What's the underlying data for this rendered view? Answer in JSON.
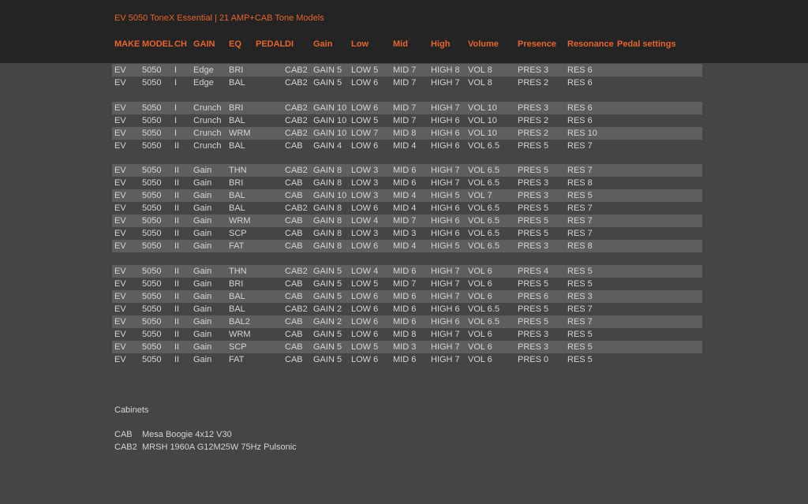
{
  "title": "EV 5050 ToneX Essential | 21 AMP+CAB Tone Models",
  "columns": [
    "MAKE",
    "MODEL",
    "CH",
    "GAIN",
    "EQ",
    "PEDAL",
    "DI",
    "Gain",
    "Low",
    "Mid",
    "High",
    "Volume",
    "Presence",
    "Resonance",
    "Pedal settings"
  ],
  "colors": {
    "accent": "#e8632a",
    "background": "#454545",
    "header_bg": "#242424",
    "row_shade": "#5e5e5e",
    "text": "#d4d4d4"
  },
  "rows": [
    {
      "shaded": true,
      "cells": [
        "EV",
        "5050",
        "I",
        "Edge",
        "BRI",
        "",
        "CAB2",
        "GAIN 5",
        "LOW 5",
        "MID 7",
        "HIGH 8",
        "VOL 8",
        "PRES 3",
        "RES 6",
        ""
      ]
    },
    {
      "shaded": false,
      "cells": [
        "EV",
        "5050",
        "I",
        "Edge",
        "BAL",
        "",
        "CAB2",
        "GAIN 5",
        "LOW 6",
        "MID 7",
        "HIGH 7",
        "VOL 8",
        "PRES 2",
        "RES 6",
        ""
      ]
    },
    {
      "shaded": true,
      "cells": [
        "EV",
        "5050",
        "I",
        "Crunch",
        "BRI",
        "",
        "CAB2",
        "GAIN 10",
        "LOW 6",
        "MID 7",
        "HIGH 7",
        "VOL 10",
        "PRES 3",
        "RES 6",
        ""
      ]
    },
    {
      "shaded": false,
      "cells": [
        "EV",
        "5050",
        "I",
        "Crunch",
        "BAL",
        "",
        "CAB2",
        "GAIN 10",
        "LOW 5",
        "MID 7",
        "HIGH 6",
        "VOL 10",
        "PRES 2",
        "RES 6",
        ""
      ]
    },
    {
      "shaded": true,
      "cells": [
        "EV",
        "5050",
        "I",
        "Crunch",
        "WRM",
        "",
        "CAB2",
        "GAIN 10",
        "LOW 7",
        "MID 8",
        "HIGH 6",
        "VOL 10",
        "PRES 2",
        "RES 10",
        ""
      ]
    },
    {
      "shaded": false,
      "cells": [
        "EV",
        "5050",
        "II",
        "Crunch",
        "BAL",
        "",
        "CAB",
        "GAIN 4",
        "LOW 6",
        "MID 4",
        "HIGH 6",
        "VOL 6.5",
        "PRES 5",
        "RES 7",
        ""
      ]
    },
    {
      "shaded": true,
      "cells": [
        "EV",
        "5050",
        "II",
        "Gain",
        "THN",
        "",
        "CAB2",
        "GAIN 8",
        "LOW 3",
        "MID 6",
        "HIGH 7",
        "VOL 6.5",
        "PRES 5",
        "RES 7",
        ""
      ]
    },
    {
      "shaded": false,
      "cells": [
        "EV",
        "5050",
        "II",
        "Gain",
        "BRI",
        "",
        "CAB",
        "GAIN 8",
        "LOW 3",
        "MID 6",
        "HIGH 7",
        "VOL 6.5",
        "PRES 3",
        "RES 8",
        ""
      ]
    },
    {
      "shaded": true,
      "cells": [
        "EV",
        "5050",
        "II",
        "Gain",
        "BAL",
        "",
        "CAB",
        "GAIN 10",
        "LOW 3",
        "MID 4",
        "HIGH 5",
        "VOL 7",
        "PRES 3",
        "RES 5",
        ""
      ]
    },
    {
      "shaded": false,
      "cells": [
        "EV",
        "5050",
        "II",
        "Gain",
        "BAL",
        "",
        "CAB2",
        "GAIN 8",
        "LOW 6",
        "MID 4",
        "HIGH 6",
        "VOL 6.5",
        "PRES 5",
        "RES 7",
        ""
      ]
    },
    {
      "shaded": true,
      "cells": [
        "EV",
        "5050",
        "II",
        "Gain",
        "WRM",
        "",
        "CAB",
        "GAIN 8",
        "LOW 4",
        "MID 7",
        "HIGH 6",
        "VOL 6.5",
        "PRES 5",
        "RES 7",
        ""
      ]
    },
    {
      "shaded": false,
      "cells": [
        "EV",
        "5050",
        "II",
        "Gain",
        "SCP",
        "",
        "CAB",
        "GAIN 8",
        "LOW 3",
        "MID 3",
        "HIGH 6",
        "VOL 6.5",
        "PRES 5",
        "RES 7",
        ""
      ]
    },
    {
      "shaded": true,
      "cells": [
        "EV",
        "5050",
        "II",
        "Gain",
        "FAT",
        "",
        "CAB",
        "GAIN 8",
        "LOW 6",
        "MID 4",
        "HIGH 5",
        "VOL 6.5",
        "PRES 3",
        "RES 8",
        ""
      ]
    },
    {
      "shaded": true,
      "cells": [
        "EV",
        "5050",
        "II",
        "Gain",
        "THN",
        "",
        "CAB2",
        "GAIN 5",
        "LOW 4",
        "MID 6",
        "HIGH 7",
        "VOL 6",
        "PRES 4",
        "RES 5",
        ""
      ]
    },
    {
      "shaded": false,
      "cells": [
        "EV",
        "5050",
        "II",
        "Gain",
        "BRI",
        "",
        "CAB",
        "GAIN 5",
        "LOW 5",
        "MID 7",
        "HIGH 7",
        "VOL 6",
        "PRES 5",
        "RES 5",
        ""
      ]
    },
    {
      "shaded": true,
      "cells": [
        "EV",
        "5050",
        "II",
        "Gain",
        "BAL",
        "",
        "CAB",
        "GAIN 5",
        "LOW 6",
        "MID 6",
        "HIGH 7",
        "VOL 6",
        "PRES 6",
        "RES 3",
        ""
      ]
    },
    {
      "shaded": false,
      "cells": [
        "EV",
        "5050",
        "II",
        "Gain",
        "BAL",
        "",
        "CAB2",
        "GAIN 2",
        "LOW 6",
        "MID 6",
        "HIGH 6",
        "VOL 6.5",
        "PRES 5",
        "RES 7",
        ""
      ]
    },
    {
      "shaded": true,
      "cells": [
        "EV",
        "5050",
        "II",
        "Gain",
        "BAL2",
        "",
        "CAB",
        "GAIN 2",
        "LOW 6",
        "MID 6",
        "HIGH 6",
        "VOL 6.5",
        "PRES 5",
        "RES 7",
        ""
      ]
    },
    {
      "shaded": false,
      "cells": [
        "EV",
        "5050",
        "II",
        "Gain",
        "WRM",
        "",
        "CAB",
        "GAIN 5",
        "LOW 6",
        "MID 8",
        "HIGH 7",
        "VOL 6",
        "PRES 3",
        "RES 5",
        ""
      ]
    },
    {
      "shaded": true,
      "cells": [
        "EV",
        "5050",
        "II",
        "Gain",
        "SCP",
        "",
        "CAB",
        "GAIN 5",
        "LOW 5",
        "MID 3",
        "HIGH 7",
        "VOL 6",
        "PRES 3",
        "RES 5",
        ""
      ]
    },
    {
      "shaded": false,
      "cells": [
        "EV",
        "5050",
        "II",
        "Gain",
        "FAT",
        "",
        "CAB",
        "GAIN 5",
        "LOW 6",
        "MID 6",
        "HIGH 7",
        "VOL 6",
        "PRES 0",
        "RES 5",
        ""
      ]
    }
  ],
  "cabinets": {
    "title": "Cabinets",
    "items": [
      {
        "code": "CAB",
        "name": "Mesa Boogie 4x12 V30"
      },
      {
        "code": "CAB2",
        "name": "MRSH 1960A G12M25W 75Hz Pulsonic"
      }
    ]
  }
}
